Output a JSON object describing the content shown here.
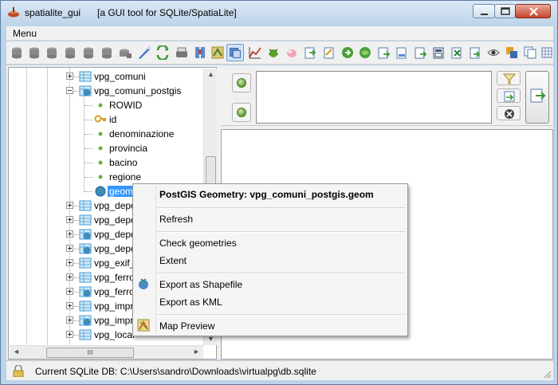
{
  "window": {
    "title": "spatialite_gui",
    "subtitle": "[a GUI tool for SQLite/SpatiaLite]"
  },
  "menu": {
    "items": [
      "Menu"
    ]
  },
  "toolbar": {
    "icons": [
      "connect-db-icon",
      "create-db-icon",
      "disconnect-db-icon",
      "memory-db-icon",
      "memory-db-new-icon",
      "memory-db-save-icon",
      "vacuum-icon",
      "sql-script-icon",
      "load-shp-icon",
      "virtual-shp-icon",
      "load-txt-icon",
      "load-dbf-icon",
      "load-xl-icon",
      "network-icon",
      "exif-icon",
      "load-xml-icon",
      "srids-icon",
      "charset-icon",
      "help-icon",
      "attach-icon",
      "sql-log-icon",
      "map-icon",
      "check-geom-icon",
      "export-icon"
    ]
  },
  "tree": {
    "items": [
      {
        "label": "vpg_comuni",
        "kind": "table"
      },
      {
        "label": "vpg_comuni_postgis",
        "kind": "geotable",
        "expanded": true
      },
      {
        "label": "ROWID",
        "kind": "column"
      },
      {
        "label": "id",
        "kind": "pk"
      },
      {
        "label": "denominazione",
        "kind": "column"
      },
      {
        "label": "provincia",
        "kind": "column"
      },
      {
        "label": "bacino",
        "kind": "column"
      },
      {
        "label": "regione",
        "kind": "column"
      },
      {
        "label": "geom",
        "kind": "geometry",
        "selected": true
      },
      {
        "label": "vpg_depo",
        "kind": "table"
      },
      {
        "label": "vpg_depo",
        "kind": "table"
      },
      {
        "label": "vpg_depo",
        "kind": "geotable"
      },
      {
        "label": "vpg_depo",
        "kind": "geotable"
      },
      {
        "label": "vpg_exif_",
        "kind": "table"
      },
      {
        "label": "vpg_ferro",
        "kind": "table"
      },
      {
        "label": "vpg_ferro",
        "kind": "geotable"
      },
      {
        "label": "vpg_impr",
        "kind": "table"
      },
      {
        "label": "vpg_impr",
        "kind": "geotable"
      },
      {
        "label": "vpg_local",
        "kind": "table"
      }
    ],
    "hscroll_grip": "III"
  },
  "context_menu": {
    "title": "PostGIS Geometry: vpg_comuni_postgis.geom",
    "items": [
      {
        "label": "Refresh"
      },
      {
        "label": "Check geometries"
      },
      {
        "label": "Extent"
      },
      {
        "label": "Export as Shapefile",
        "icon": "globe-icon"
      },
      {
        "label": "Export as KML"
      },
      {
        "label": "Map Preview",
        "icon": "map-preview-icon"
      }
    ]
  },
  "statusbar": {
    "text": "Current SQLite DB: C:\\Users\\sandro\\Downloads\\virtualpg\\db.sqlite"
  },
  "colors": {
    "selection": "#3399ff",
    "titlebar": "#bfd4ea",
    "close_button": "#c7452b"
  }
}
